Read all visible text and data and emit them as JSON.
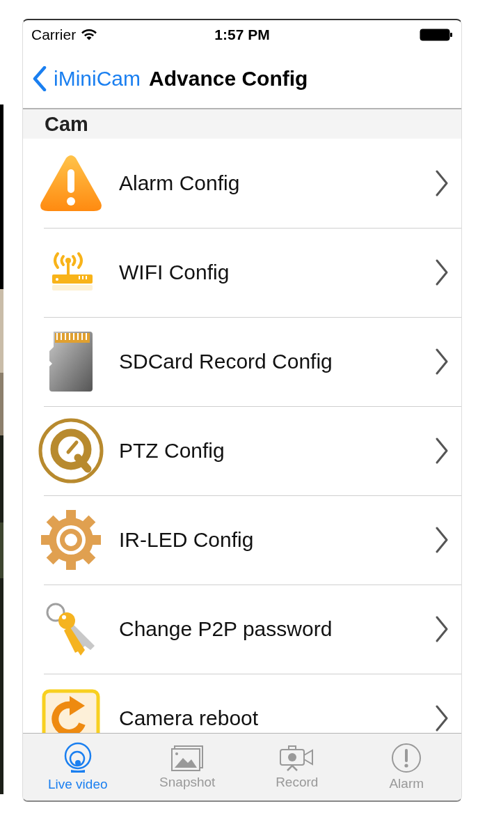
{
  "status_bar": {
    "carrier": "Carrier",
    "time": "1:57 PM"
  },
  "nav_bar": {
    "back": "iMiniCam",
    "title": "Advance Config"
  },
  "section": {
    "header": "Cam"
  },
  "items": [
    {
      "label": "Alarm Config"
    },
    {
      "label": "WIFI Config"
    },
    {
      "label": "SDCard Record Config"
    },
    {
      "label": "PTZ Config"
    },
    {
      "label": "IR-LED Config"
    },
    {
      "label": "Change P2P password"
    },
    {
      "label": "Camera reboot"
    }
  ],
  "tab_bar": [
    {
      "label": "Live video",
      "selected": true
    },
    {
      "label": "Snapshot",
      "selected": false
    },
    {
      "label": "Record",
      "selected": false
    },
    {
      "label": "Alarm",
      "selected": false
    }
  ]
}
